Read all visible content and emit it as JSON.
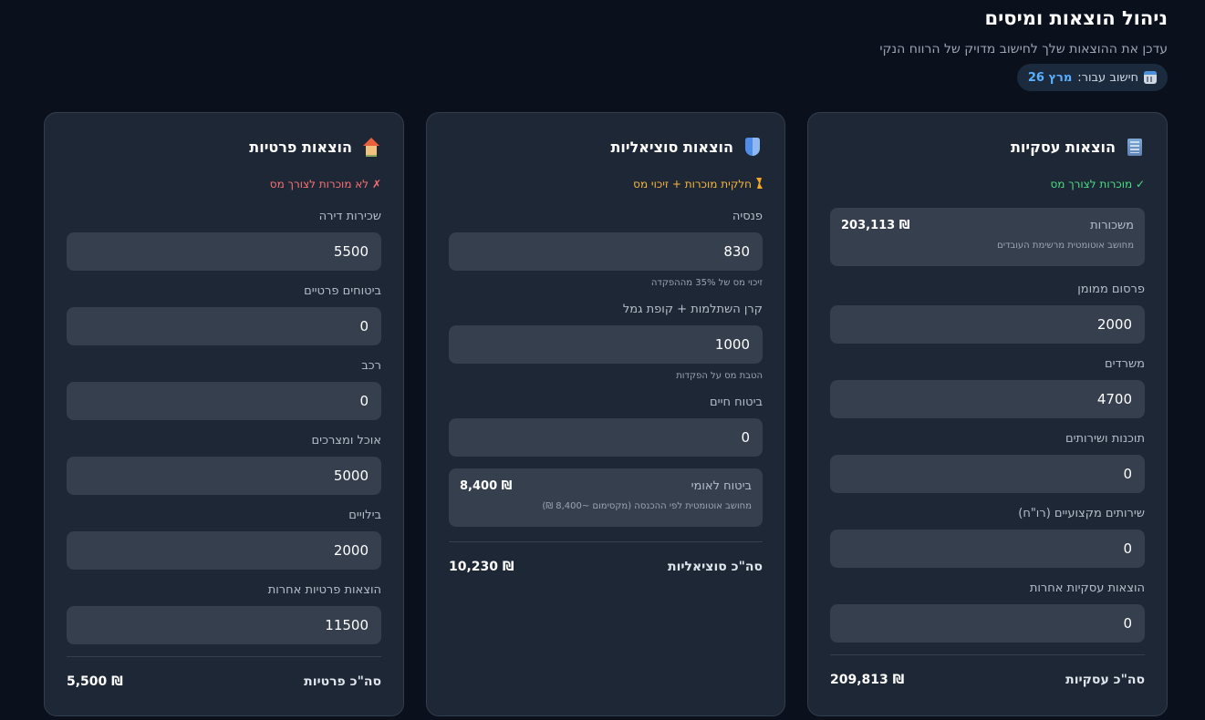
{
  "header": {
    "title": "ניהול הוצאות ומיסים",
    "subtitle": "עדכן את ההוצאות שלך לחישוב מדויק של הרווח הנקי",
    "period_label": "חישוב עבור:",
    "period_value": "מרץ 26",
    "period_icon": "calendar-icon"
  },
  "business": {
    "title": "הוצאות עסקיות",
    "icon": "building-icon",
    "tax_note": "✓ מוכרות לצורך מס",
    "salaries": {
      "label": "משכורות",
      "value": "203,113 ₪",
      "description": "מחושב אוטומטית מרשימת העובדים"
    },
    "fields": [
      {
        "label": "פרסום ממומן",
        "value": "2000"
      },
      {
        "label": "משרדים",
        "value": "4700"
      },
      {
        "label": "תוכנות ושירותים",
        "value": "0"
      },
      {
        "label": "שירותים מקצועיים (רו\"ח)",
        "value": "0"
      },
      {
        "label": "הוצאות עסקיות אחרות",
        "value": "0"
      }
    ],
    "total_label": "סה\"כ עסקיות",
    "total_value": "209,813 ₪"
  },
  "social": {
    "title": "הוצאות סוציאליות",
    "icon": "shield-icon",
    "tax_note": "חלקית מוכרות + זיכוי מס",
    "fields": [
      {
        "label": "פנסיה",
        "value": "830",
        "hint": "זיכוי מס של 35% מההפקדה"
      },
      {
        "label": "קרן השתלמות + קופת גמל",
        "value": "1000",
        "hint": "הטבת מס על הפקדות"
      },
      {
        "label": "ביטוח חיים",
        "value": "0"
      }
    ],
    "national_insurance": {
      "label": "ביטוח לאומי",
      "value": "8,400 ₪",
      "description": "מחושב אוטומטית לפי ההכנסה (מקסימום ~8,400 ₪)"
    },
    "total_label": "סה\"כ סוציאליות",
    "total_value": "10,230 ₪"
  },
  "private": {
    "title": "הוצאות פרטיות",
    "icon": "house-icon",
    "tax_note": "✗ לא מוכרות לצורך מס",
    "fields": [
      {
        "label": "שכירות דירה",
        "value": "5500"
      },
      {
        "label": "ביטוחים פרטיים",
        "value": "0"
      },
      {
        "label": "רכב",
        "value": "0"
      },
      {
        "label": "אוכל ומצרכים",
        "value": "5000"
      },
      {
        "label": "בילויים",
        "value": "2000"
      },
      {
        "label": "הוצאות פרטיות אחרות",
        "value": "11500"
      }
    ],
    "total_label": "סה\"כ פרטיות",
    "total_value": "5,500 ₪"
  },
  "colors": {
    "background": "#0b111c",
    "card": "#1e2736",
    "input": "#353f4e",
    "accent_blue": "#5ab0ff",
    "green": "#4ade80",
    "orange": "#f5b73b",
    "red": "#f87171"
  }
}
